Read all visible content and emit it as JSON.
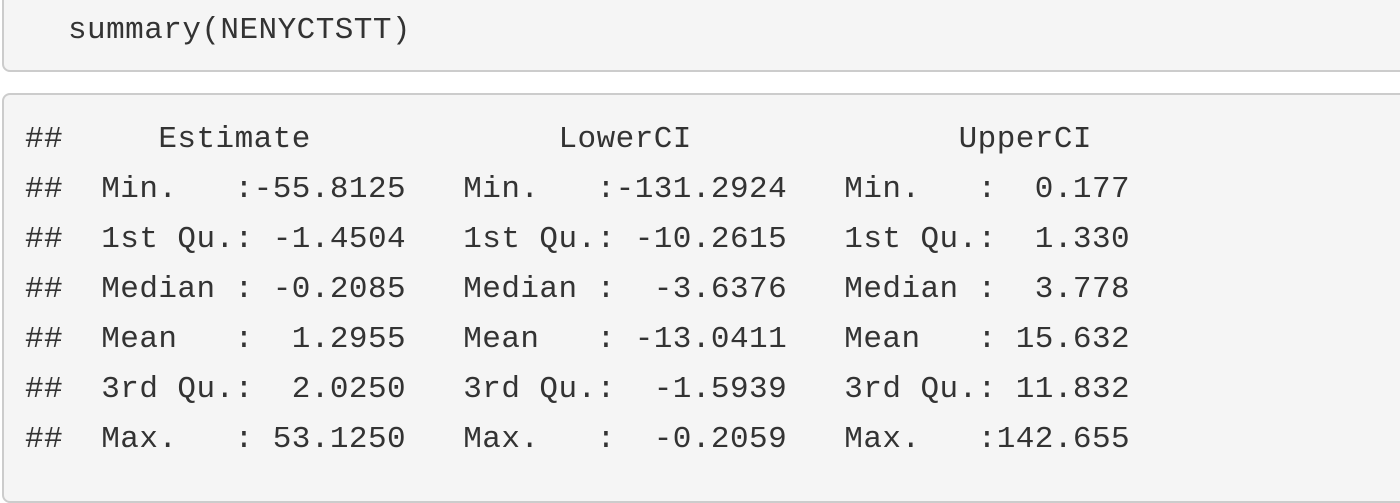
{
  "code_input": "summary(NENYCTSTT)",
  "output_lines": [
    "##     Estimate             LowerCI              UpperCI      ",
    "##  Min.   :-55.8125   Min.   :-131.2924   Min.   :  0.177  ",
    "##  1st Qu.: -1.4504   1st Qu.: -10.2615   1st Qu.:  1.330  ",
    "##  Median : -0.2085   Median :  -3.6376   Median :  3.778  ",
    "##  Mean   :  1.2955   Mean   : -13.0411   Mean   : 15.632  ",
    "##  3rd Qu.:  2.0250   3rd Qu.:  -1.5939   3rd Qu.: 11.832  ",
    "##  Max.   : 53.1250   Max.   :  -0.2059   Max.   :142.655  "
  ]
}
